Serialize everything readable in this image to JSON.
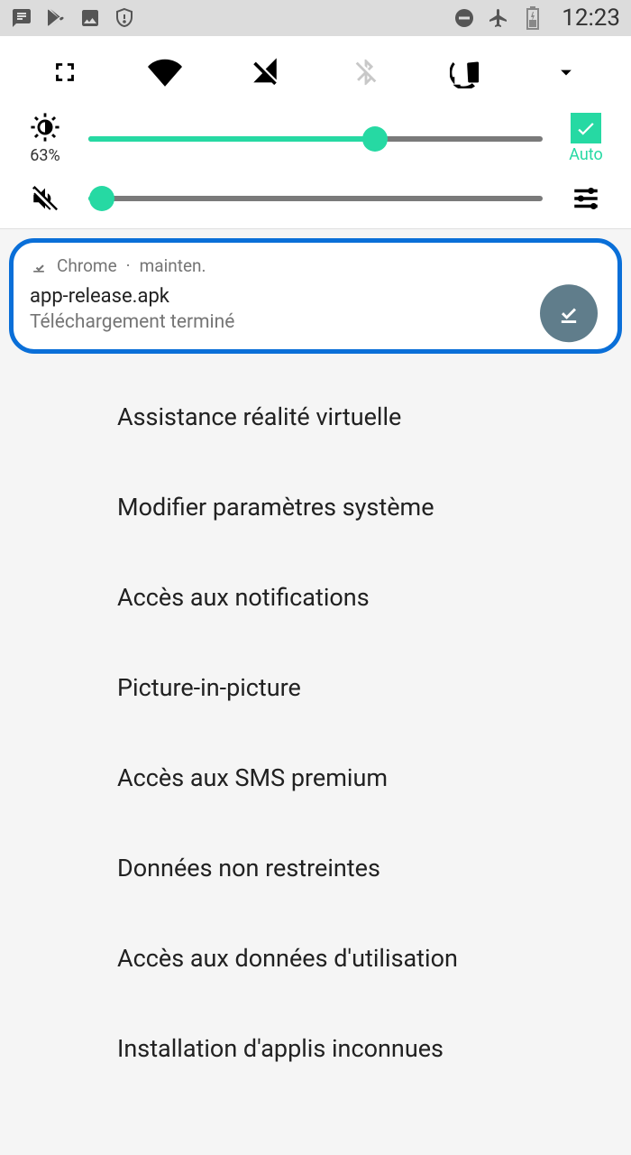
{
  "status_bar": {
    "time": "12:23"
  },
  "quick_settings": {
    "brightness_percent": "63%",
    "brightness_value": 63,
    "auto_label": "Auto",
    "volume_value": 3
  },
  "notification": {
    "app": "Chrome",
    "separator": "·",
    "time": "mainten.",
    "title": "app-release.apk",
    "subtitle": "Téléchargement terminé"
  },
  "settings": {
    "items": [
      "Assistance réalité virtuelle",
      "Modifier paramètres système",
      "Accès aux notifications",
      "Picture-in-picture",
      "Accès aux SMS premium",
      "Données non restreintes",
      "Accès aux données d'utilisation",
      "Installation d'applis inconnues"
    ]
  }
}
